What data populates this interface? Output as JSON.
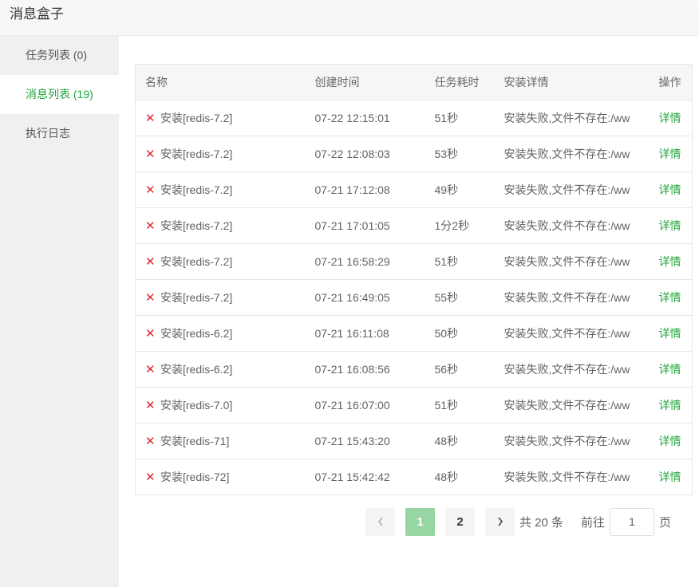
{
  "window": {
    "title": "消息盒子"
  },
  "sidebar": {
    "items": [
      {
        "label": "任务列表 (0)",
        "active": false
      },
      {
        "label": "消息列表 (19)",
        "active": true
      },
      {
        "label": "执行日志",
        "active": false
      }
    ]
  },
  "table": {
    "columns": [
      "名称",
      "创建时间",
      "任务耗时",
      "安装详情",
      "操作"
    ],
    "rows": [
      {
        "name": "安装[redis-7.2]",
        "time": "07-22 12:15:01",
        "duration": "51秒",
        "detail": "安装失败,文件不存在:/ww",
        "action": "详情"
      },
      {
        "name": "安装[redis-7.2]",
        "time": "07-22 12:08:03",
        "duration": "53秒",
        "detail": "安装失败,文件不存在:/ww",
        "action": "详情"
      },
      {
        "name": "安装[redis-7.2]",
        "time": "07-21 17:12:08",
        "duration": "49秒",
        "detail": "安装失败,文件不存在:/ww",
        "action": "详情"
      },
      {
        "name": "安装[redis-7.2]",
        "time": "07-21 17:01:05",
        "duration": "1分2秒",
        "detail": "安装失败,文件不存在:/ww",
        "action": "详情"
      },
      {
        "name": "安装[redis-7.2]",
        "time": "07-21 16:58:29",
        "duration": "51秒",
        "detail": "安装失败,文件不存在:/ww",
        "action": "详情"
      },
      {
        "name": "安装[redis-7.2]",
        "time": "07-21 16:49:05",
        "duration": "55秒",
        "detail": "安装失败,文件不存在:/ww",
        "action": "详情"
      },
      {
        "name": "安装[redis-6.2]",
        "time": "07-21 16:11:08",
        "duration": "50秒",
        "detail": "安装失败,文件不存在:/ww",
        "action": "详情"
      },
      {
        "name": "安装[redis-6.2]",
        "time": "07-21 16:08:56",
        "duration": "56秒",
        "detail": "安装失败,文件不存在:/ww",
        "action": "详情"
      },
      {
        "name": "安装[redis-7.0]",
        "time": "07-21 16:07:00",
        "duration": "51秒",
        "detail": "安装失败,文件不存在:/ww",
        "action": "详情"
      },
      {
        "name": "安装[redis-71]",
        "time": "07-21 15:43:20",
        "duration": "48秒",
        "detail": "安装失败,文件不存在:/ww",
        "action": "详情"
      },
      {
        "name": "安装[redis-72]",
        "time": "07-21 15:42:42",
        "duration": "48秒",
        "detail": "安装失败,文件不存在:/ww",
        "action": "详情"
      }
    ]
  },
  "pagination": {
    "prev_icon": "chevron-left-icon",
    "next_icon": "chevron-right-icon",
    "pages": [
      "1",
      "2"
    ],
    "current": "1",
    "total_text": "共 20 条",
    "goto_label": "前往",
    "goto_value": "1",
    "page_suffix": "页"
  },
  "icons": {
    "status": "close-icon"
  },
  "colors": {
    "accent": "#20a53a",
    "error": "#d9252f",
    "active_page": "#97d5a3"
  }
}
